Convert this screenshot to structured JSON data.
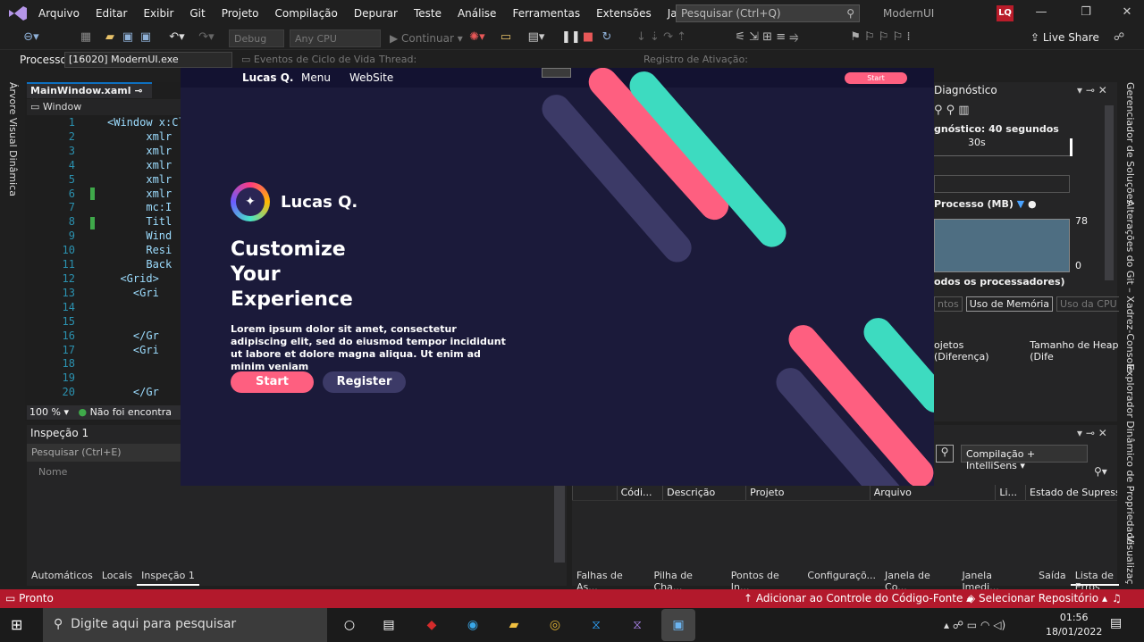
{
  "vs": {
    "menu": [
      "Arquivo",
      "Editar",
      "Exibir",
      "Git",
      "Projeto",
      "Compilação",
      "Depurar",
      "Teste",
      "Análise",
      "Ferramentas",
      "Extensões",
      "Janela",
      "Ajuda"
    ],
    "search_placeholder": "Pesquisar (Ctrl+Q)",
    "title": "ModernUI",
    "avatar_initials": "LQ",
    "toolbar": {
      "config": "Debug",
      "platform": "Any CPU",
      "continue": "Continuar",
      "live_share": "Live Share"
    },
    "process_label": "Processo:",
    "process_value": "[16020] ModernUI.exe",
    "lifecycle_events": "Eventos de Ciclo de Vida",
    "thread_label": "Thread:",
    "activation_label": "Registro de Ativação:",
    "left_strip": "Árvore Visual Dinâmica",
    "editor": {
      "tab": "MainWindow.xaml",
      "breadcrumb": "Window",
      "lines": [
        "1",
        "2",
        "3",
        "4",
        "5",
        "6",
        "7",
        "8",
        "9",
        "10",
        "11",
        "12",
        "13",
        "14",
        "15",
        "16",
        "17",
        "18",
        "19",
        "20"
      ],
      "code": [
        "<Window x:Cl",
        "      xmlr",
        "      xmlr",
        "      xmlr",
        "      xmlr",
        "      xmlr",
        "      mc:I",
        "      Titl",
        "      Wind",
        "      Resi",
        "      Back",
        "  <Grid>",
        "    <Gri",
        "",
        "",
        "    </Gr",
        "    <Gri",
        "",
        "",
        "    </Gr"
      ],
      "zoom": "100 %",
      "status": "Não foi encontra"
    },
    "inspect": {
      "title": "Inspeção 1",
      "search": "Pesquisar (Ctrl+E)",
      "col_name": "Nome",
      "tabs": [
        "Automáticos",
        "Locais",
        "Inspeção 1"
      ]
    },
    "diag": {
      "title": "Diagnóstico",
      "session": "gnóstico: 40 segundos",
      "tick": "30s",
      "mem_label": "Processo (MB)",
      "mem_max": "78",
      "mem_min": "0",
      "cpu_label": "odos os processadores)",
      "tabs": [
        "ntos",
        "Uso de Memória",
        "Uso da CPU"
      ],
      "cols": [
        "ojetos (Diferença)",
        "Tamanho de Heap (Dife"
      ]
    },
    "errors": {
      "filter": "Compilação + IntelliSens",
      "cols": [
        "Códi...",
        "Descrição",
        "Projeto",
        "Arquivo",
        "Li...",
        "Estado de Supressão"
      ],
      "tabs": [
        "Falhas de As...",
        "Pilha de Cha...",
        "Pontos de In...",
        "Configuraçõ...",
        "Janela de Co...",
        "Janela Imedi...",
        "Saída",
        "Lista de Erros"
      ]
    },
    "right_strip": [
      "Gerenciador de Soluções",
      "Alterações do Git – Xadrez-Console",
      "Explorador Dinâmico de Propriedade",
      "Visualizaç"
    ],
    "status": {
      "left": "Pronto",
      "source_control": "Adicionar ao Controle do Código-Fonte",
      "repo": "Selecionar Repositório"
    }
  },
  "app": {
    "nav": [
      "Lucas Q.",
      "Menu",
      "WebSite"
    ],
    "nav_button": "Start",
    "brand": "Lucas Q.",
    "headline": [
      "Customize",
      "Your",
      "Experience"
    ],
    "paragraph": "Lorem ipsum dolor sit amet, consectetur adipiscing elit, sed do eiusmod tempor incididunt ut labore et dolore magna aliqua. Ut enim ad minim veniam",
    "buttons": {
      "start": "Start",
      "register": "Register"
    },
    "colors": {
      "background": "#1b1a3a",
      "pink": "#fe5f80",
      "teal": "#3ddbc0",
      "purple": "#3c3a67"
    }
  },
  "taskbar": {
    "search": "Digite aqui para pesquisar",
    "time": "01:56",
    "date": "18/01/2022"
  }
}
